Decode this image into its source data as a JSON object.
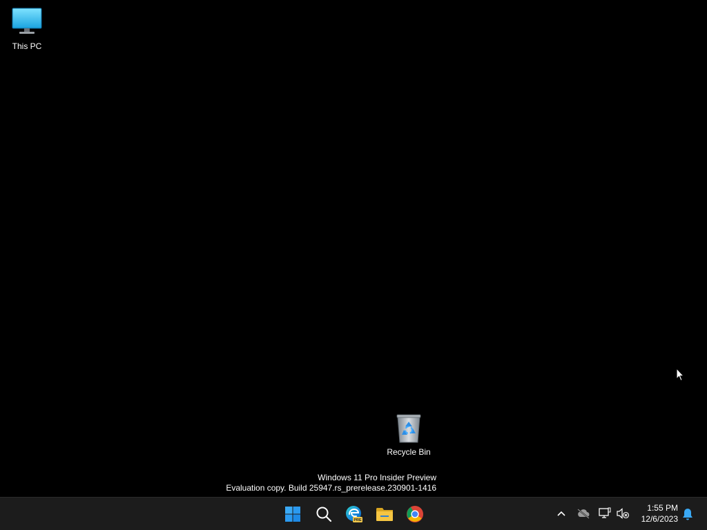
{
  "desktop": {
    "icons": [
      {
        "label": "This PC",
        "icon": "monitor-icon"
      },
      {
        "label": "Recycle Bin",
        "icon": "recycle-bin-icon"
      }
    ],
    "watermark": {
      "line1": "Windows 11 Pro Insider Preview",
      "line2": "Evaluation copy. Build 25947.rs_prerelease.230901-1416"
    }
  },
  "taskbar": {
    "pinned": [
      {
        "name": "Start",
        "icon": "windows-logo-icon"
      },
      {
        "name": "Search",
        "icon": "search-icon"
      },
      {
        "name": "Microsoft Edge",
        "icon": "edge-icon",
        "badge": "PRE"
      },
      {
        "name": "File Explorer",
        "icon": "folder-icon"
      },
      {
        "name": "Google Chrome",
        "icon": "chrome-icon"
      }
    ],
    "tray": {
      "icons": [
        "chevron-up-icon",
        "cloud-offline-icon",
        "network-icon",
        "volume-muted-icon",
        "bell-icon"
      ],
      "time": "1:55 PM",
      "date": "12/6/2023"
    }
  },
  "colors": {
    "desktop_bg": "#000000",
    "taskbar_bg": "#1c1c1c",
    "accent": "#2fa8f5",
    "folder": "#f5c542"
  }
}
